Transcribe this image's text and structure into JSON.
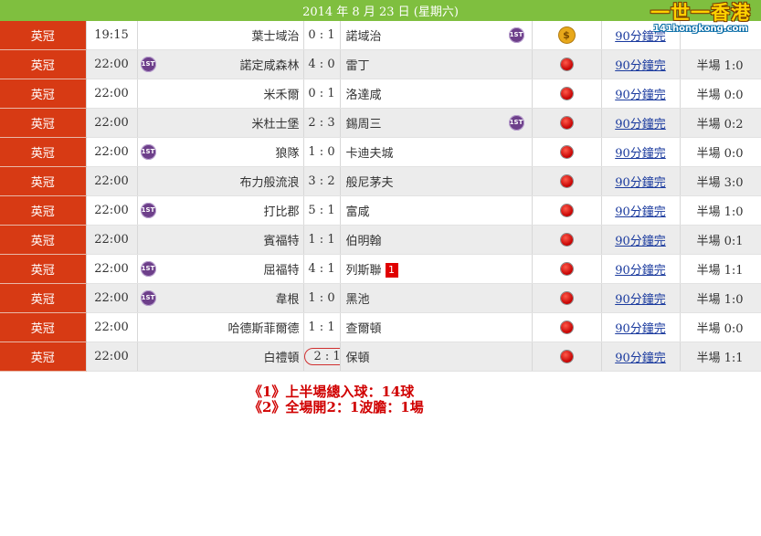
{
  "header": {
    "date": "2014 年 8 月 23 日 (星期六)"
  },
  "logo": {
    "text": "一世一香港",
    "url": "141hongkong.com"
  },
  "matches": [
    {
      "league": "英冠",
      "time": "19:15",
      "home": "葉士域治",
      "score": "0 : 1",
      "away": "諾域治",
      "home_1st": false,
      "away_1st": true,
      "marker": "coin",
      "coin_symbol": "$",
      "link": "90分鐘完",
      "half": "",
      "red_card": "",
      "circled": false
    },
    {
      "league": "英冠",
      "time": "22:00",
      "home": "諾定咸森林",
      "score": "4 : 0",
      "away": "雷丁",
      "home_1st": true,
      "away_1st": false,
      "marker": "dot",
      "link": "90分鐘完",
      "half": "半場 1:0",
      "red_card": "",
      "circled": false
    },
    {
      "league": "英冠",
      "time": "22:00",
      "home": "米禾爾",
      "score": "0 : 1",
      "away": "洛達咸",
      "home_1st": false,
      "away_1st": false,
      "marker": "dot",
      "link": "90分鐘完",
      "half": "半場 0:0",
      "red_card": "",
      "circled": false
    },
    {
      "league": "英冠",
      "time": "22:00",
      "home": "米杜士堡",
      "score": "2 : 3",
      "away": "錫周三",
      "home_1st": false,
      "away_1st": true,
      "marker": "dot",
      "link": "90分鐘完",
      "half": "半場 0:2",
      "red_card": "",
      "circled": false
    },
    {
      "league": "英冠",
      "time": "22:00",
      "home": "狼隊",
      "score": "1 : 0",
      "away": "卡迪夫城",
      "home_1st": true,
      "away_1st": false,
      "marker": "dot",
      "link": "90分鐘完",
      "half": "半場 0:0",
      "red_card": "",
      "circled": false
    },
    {
      "league": "英冠",
      "time": "22:00",
      "home": "布力般流浪",
      "score": "3 : 2",
      "away": "般尼茅夫",
      "home_1st": false,
      "away_1st": false,
      "marker": "dot",
      "link": "90分鐘完",
      "half": "半場 3:0",
      "red_card": "",
      "circled": false
    },
    {
      "league": "英冠",
      "time": "22:00",
      "home": "打比郡",
      "score": "5 : 1",
      "away": "富咸",
      "home_1st": true,
      "away_1st": false,
      "marker": "dot",
      "link": "90分鐘完",
      "half": "半場 1:0",
      "red_card": "",
      "circled": false
    },
    {
      "league": "英冠",
      "time": "22:00",
      "home": "賓福特",
      "score": "1 : 1",
      "away": "伯明翰",
      "home_1st": false,
      "away_1st": false,
      "marker": "dot",
      "link": "90分鐘完",
      "half": "半場 0:1",
      "red_card": "",
      "circled": false
    },
    {
      "league": "英冠",
      "time": "22:00",
      "home": "屈福特",
      "score": "4 : 1",
      "away": "列斯聯",
      "home_1st": true,
      "away_1st": false,
      "marker": "dot",
      "link": "90分鐘完",
      "half": "半場 1:1",
      "red_card": "1",
      "circled": false
    },
    {
      "league": "英冠",
      "time": "22:00",
      "home": "韋根",
      "score": "1 : 0",
      "away": "黑池",
      "home_1st": true,
      "away_1st": false,
      "marker": "dot",
      "link": "90分鐘完",
      "half": "半場 1:0",
      "red_card": "",
      "circled": false
    },
    {
      "league": "英冠",
      "time": "22:00",
      "home": "哈德斯菲爾德",
      "score": "1 : 1",
      "away": "查爾頓",
      "home_1st": false,
      "away_1st": false,
      "marker": "dot",
      "link": "90分鐘完",
      "half": "半場 0:0",
      "red_card": "",
      "circled": false
    },
    {
      "league": "英冠",
      "time": "22:00",
      "home": "白禮頓",
      "score": "2 : 1",
      "away": "保頓",
      "home_1st": false,
      "away_1st": false,
      "marker": "dot",
      "link": "90分鐘完",
      "half": "半場 1:1",
      "red_card": "",
      "circled": true
    }
  ],
  "badge_text": "1ST",
  "notes": [
    "《1》上半場總入球：14球",
    "《2》全場開2：1波膽：1場"
  ],
  "colors": {
    "header_bg": "#7fbf3f",
    "league_bg": "#d73a14",
    "note_color": "#d00000"
  }
}
